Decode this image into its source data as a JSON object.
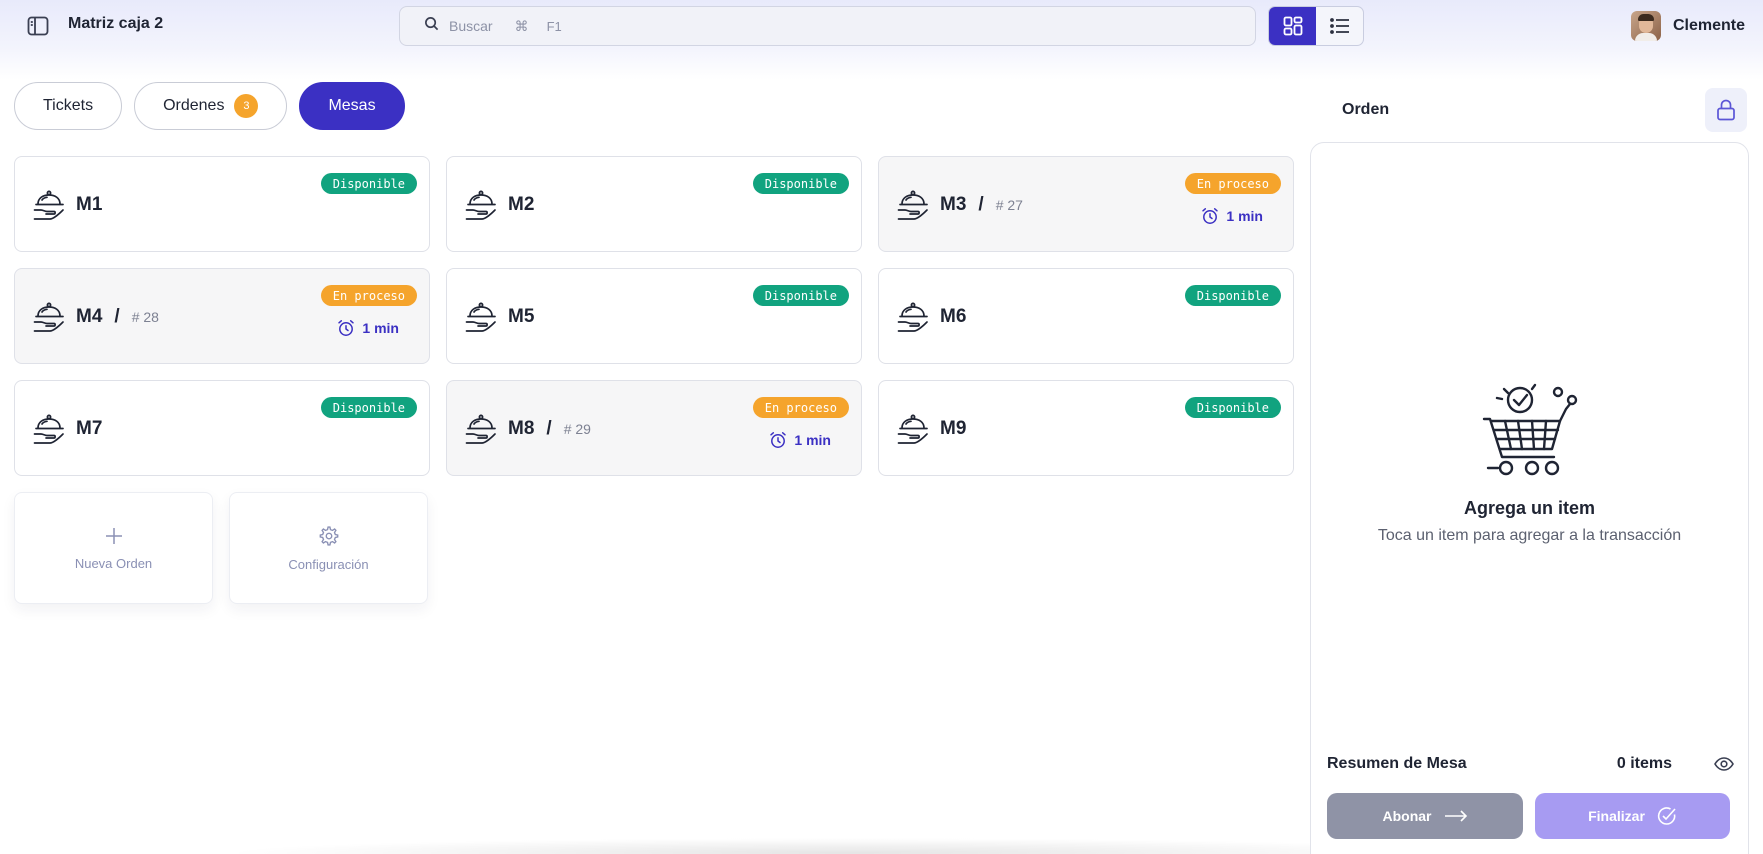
{
  "header": {
    "title": "Matriz caja 2",
    "search_placeholder": "Buscar",
    "shortcut_key": "⌘",
    "shortcut_fkey": "F1",
    "user_name": "Clemente"
  },
  "tabs": [
    {
      "label": "Tickets",
      "badge": ""
    },
    {
      "label": "Ordenes",
      "badge": "3"
    },
    {
      "label": "Mesas",
      "badge": ""
    }
  ],
  "tables": [
    {
      "name": "M1",
      "status": "Disponible",
      "order": "",
      "time": ""
    },
    {
      "name": "M2",
      "status": "Disponible",
      "order": "",
      "time": ""
    },
    {
      "name": "M3",
      "status": "En proceso",
      "order": "# 27",
      "time": "1 min"
    },
    {
      "name": "M4",
      "status": "En proceso",
      "order": "# 28",
      "time": "1 min"
    },
    {
      "name": "M5",
      "status": "Disponible",
      "order": "",
      "time": ""
    },
    {
      "name": "M6",
      "status": "Disponible",
      "order": "",
      "time": ""
    },
    {
      "name": "M7",
      "status": "Disponible",
      "order": "",
      "time": ""
    },
    {
      "name": "M8",
      "status": "En proceso",
      "order": "# 29",
      "time": "1 min"
    },
    {
      "name": "M9",
      "status": "Disponible",
      "order": "",
      "time": ""
    }
  ],
  "actions": {
    "new_order": "Nueva Orden",
    "settings": "Configuración"
  },
  "order_panel": {
    "title": "Orden",
    "empty_title": "Agrega un item",
    "empty_subtitle": "Toca un item para agregar a la transacción",
    "summary_label": "Resumen de Mesa",
    "summary_count": "0 items",
    "abonar_label": "Abonar",
    "finalizar_label": "Finalizar"
  },
  "colors": {
    "accent": "#3b30c3",
    "available": "#11a37f",
    "in_progress": "#f5a42c",
    "abonar": "#8f93a6",
    "finalizar": "#a79bf2"
  }
}
